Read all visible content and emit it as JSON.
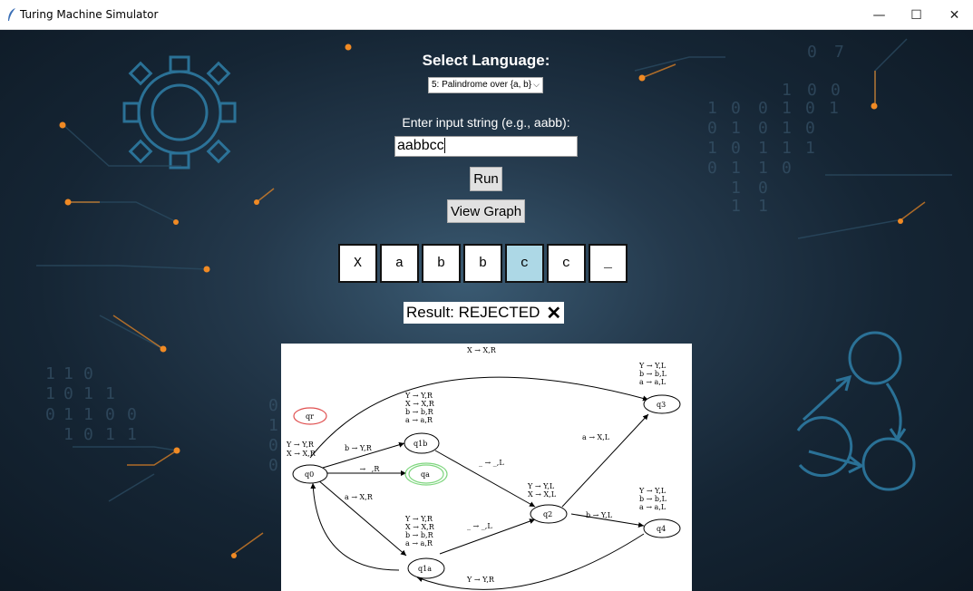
{
  "window": {
    "title": "Turing Machine Simulator",
    "minimize": "—",
    "maximize": "☐",
    "close": "✕"
  },
  "language": {
    "heading": "Select Language:",
    "selected": "5: Palindrome over {a, b}",
    "chevron": "⌵"
  },
  "input": {
    "label": "Enter input string (e.g., aabb):",
    "value": "aabbcc"
  },
  "buttons": {
    "run": "Run",
    "view_graph": "View Graph"
  },
  "tape": {
    "cells": [
      "X",
      "a",
      "b",
      "b",
      "c",
      "c",
      "_"
    ],
    "head_index": 4,
    "head_color": "#add8e6"
  },
  "result": {
    "text": "Result: REJECTED",
    "icon": "✕"
  },
  "graph": {
    "states": [
      "qr",
      "q0",
      "q1b",
      "qa",
      "q2",
      "q1a",
      "q3",
      "q4"
    ],
    "edges": [
      "X → X,R",
      "Y → Y,R",
      "X → X,R",
      "b → Y,R",
      "_ → _,R",
      "a → X,R",
      "Y → Y,R",
      "X → X,R",
      "b → b,R",
      "a → a,R",
      "_ → _,L",
      "Y → Y,L",
      "X → X,L",
      "a → X,L",
      "b → Y,L",
      "Y → Y,L",
      "b → b,L",
      "a → a,L",
      "Y → Y,R",
      "X → X,R",
      "b → b,R",
      "a → a,R",
      "_ → _,L",
      "Y → Y,L",
      "b → b,L",
      "a → a,L",
      "Y → Y,R"
    ]
  },
  "colors": {
    "accept_state": "#7fd67f",
    "reject_state": "#e05050",
    "background": "#152534",
    "node_orange": "#f08a24"
  }
}
